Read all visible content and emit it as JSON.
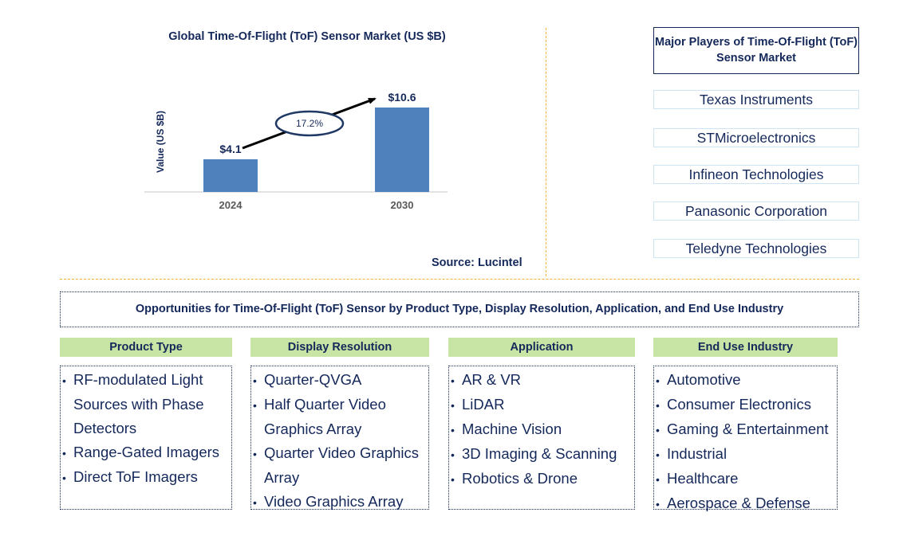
{
  "chart_data": {
    "type": "bar",
    "title": "Global Time-Of-Flight (ToF) Sensor Market (US $B)",
    "xlabel": "",
    "ylabel": "Value (US $B)",
    "categories": [
      "2024",
      "2030"
    ],
    "values": [
      4.1,
      10.6
    ],
    "data_labels": [
      "$4.1",
      "$10.6"
    ],
    "ylim": [
      0,
      11
    ],
    "grid": false,
    "bar_color": "#4f81bd",
    "annotation": {
      "type": "cagr-arrow",
      "label": "17.2%"
    }
  },
  "source": "Source: Lucintel",
  "players": {
    "title": "Major Players of Time-Of-Flight (ToF) Sensor Market",
    "items": [
      "Texas Instruments",
      "STMicroelectronics",
      "Infineon Technologies",
      "Panasonic Corporation",
      "Teledyne Technologies"
    ]
  },
  "opportunities": {
    "title": "Opportunities for Time-Of-Flight (ToF) Sensor by Product Type, Display Resolution, Application, and End Use Industry",
    "categories": [
      {
        "header": "Product Type",
        "items": [
          "RF-modulated Light Sources with Phase Detectors",
          "Range-Gated Imagers",
          "Direct ToF Imagers"
        ]
      },
      {
        "header": "Display Resolution",
        "items": [
          "Quarter-QVGA",
          "Half Quarter Video Graphics Array",
          "Quarter Video Graphics Array",
          "Video Graphics Array"
        ]
      },
      {
        "header": "Application",
        "items": [
          "AR & VR",
          "LiDAR",
          "Machine Vision",
          "3D Imaging & Scanning",
          "Robotics & Drone"
        ]
      },
      {
        "header": "End Use Industry",
        "items": [
          "Automotive",
          "Consumer Electronics",
          "Gaming & Entertainment",
          "Industrial",
          "Healthcare",
          "Aerospace & Defense"
        ]
      }
    ]
  }
}
